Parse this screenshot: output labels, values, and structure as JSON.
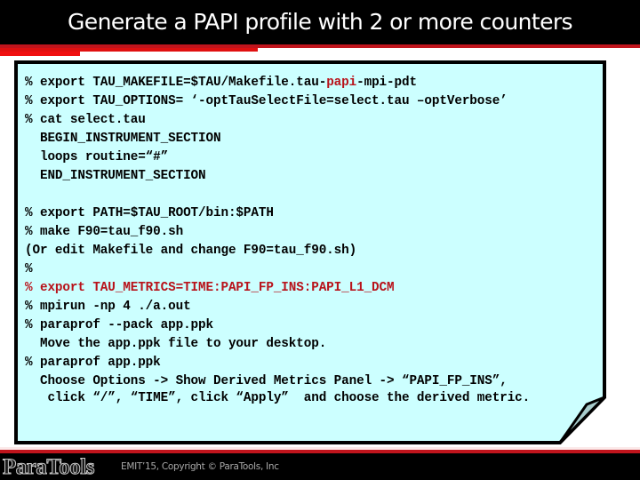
{
  "slide": {
    "title": "Generate a PAPI profile with 2 or more counters",
    "colors": {
      "note_background": "#ccffff",
      "highlight_red": "#b8121a",
      "title_bar": "#000000",
      "accent_red": "#c0141c"
    }
  },
  "code_block": {
    "lines": [
      {
        "parts": [
          {
            "text": "% export TAU_MAKEFILE=$TAU/Makefile.tau-",
            "red": false
          },
          {
            "text": "papi",
            "red": true
          },
          {
            "text": "-mpi-pdt",
            "red": false
          }
        ]
      },
      {
        "parts": [
          {
            "text": "% export TAU_OPTIONS= ‘-optTauSelectFile=select.tau –optVerbose’",
            "red": false
          }
        ]
      },
      {
        "parts": [
          {
            "text": "% cat select.tau",
            "red": false
          }
        ]
      },
      {
        "parts": [
          {
            "text": "  BEGIN_INSTRUMENT_SECTION",
            "red": false
          }
        ]
      },
      {
        "parts": [
          {
            "text": "  loops routine=“#”",
            "red": false
          }
        ]
      },
      {
        "parts": [
          {
            "text": "  END_INSTRUMENT_SECTION",
            "red": false
          }
        ]
      },
      {
        "parts": [
          {
            "text": "",
            "red": false
          }
        ]
      },
      {
        "parts": [
          {
            "text": "% export PATH=$TAU_ROOT/bin:$PATH",
            "red": false
          }
        ]
      },
      {
        "parts": [
          {
            "text": "% make F90=tau_f90.sh",
            "red": false
          }
        ]
      },
      {
        "parts": [
          {
            "text": "(Or edit Makefile and change F90=tau_f90.sh)",
            "red": false
          }
        ]
      },
      {
        "parts": [
          {
            "text": "%",
            "red": false
          }
        ]
      },
      {
        "parts": [
          {
            "text": "% export TAU_METRICS=TIME:PAPI_FP_INS:PAPI_L1_DCM",
            "red": true
          }
        ]
      },
      {
        "parts": [
          {
            "text": "% mpirun -np 4 ./a.out",
            "red": false
          }
        ]
      },
      {
        "parts": [
          {
            "text": "% paraprof --pack app.ppk",
            "red": false
          }
        ]
      },
      {
        "parts": [
          {
            "text": "  Move the app.ppk file to your desktop.",
            "red": false
          }
        ]
      },
      {
        "parts": [
          {
            "text": "% paraprof app.ppk",
            "red": false
          }
        ]
      },
      {
        "parts": [
          {
            "text": "  Choose Options -> Show Derived Metrics Panel -> “PAPI_FP_INS”,",
            "red": false
          }
        ]
      },
      {
        "parts": [
          {
            "text": "   click “/”, “TIME”, click “Apply”  and choose the derived metric.",
            "red": false
          }
        ]
      }
    ]
  },
  "footer": {
    "logo": "ParaTools",
    "copyright": "EMIT’15, Copyright © ParaTools, Inc"
  }
}
